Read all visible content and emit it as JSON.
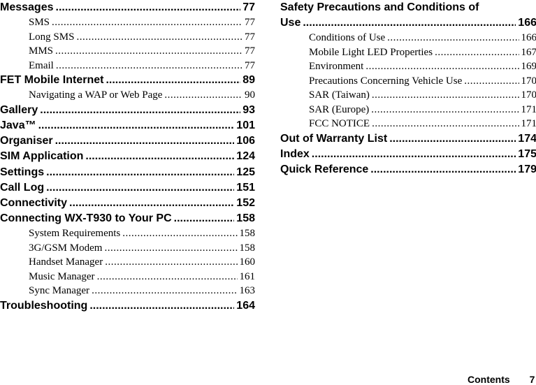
{
  "left": [
    {
      "type": "h",
      "title": "Messages",
      "page": "77"
    },
    {
      "type": "s",
      "title": "SMS",
      "page": "77"
    },
    {
      "type": "s",
      "title": "Long SMS",
      "page": "77"
    },
    {
      "type": "s",
      "title": "MMS",
      "page": "77"
    },
    {
      "type": "s",
      "title": "Email",
      "page": "77"
    },
    {
      "type": "h",
      "title": "FET Mobile Internet",
      "page": "89"
    },
    {
      "type": "s",
      "title": "Navigating a WAP or Web Page",
      "page": "90"
    },
    {
      "type": "h",
      "title": "Gallery",
      "page": "93"
    },
    {
      "type": "h",
      "title": "Java™",
      "page": "101"
    },
    {
      "type": "h",
      "title": "Organiser",
      "page": "106"
    },
    {
      "type": "h",
      "title": "SIM Application",
      "page": "124"
    },
    {
      "type": "h",
      "title": "Settings",
      "page": "125"
    },
    {
      "type": "h",
      "title": "Call Log",
      "page": "151"
    },
    {
      "type": "h",
      "title": "Connectivity",
      "page": "152"
    },
    {
      "type": "h",
      "title": "Connecting WX-T930 to Your PC",
      "page": "158"
    },
    {
      "type": "s",
      "title": "System Requirements",
      "page": "158"
    },
    {
      "type": "s",
      "title": "3G/GSM Modem",
      "page": "158"
    },
    {
      "type": "s",
      "title": "Handset Manager",
      "page": "160"
    },
    {
      "type": "s",
      "title": "Music Manager",
      "page": "161"
    },
    {
      "type": "s",
      "title": "Sync Manager",
      "page": "163"
    },
    {
      "type": "h",
      "title": "Troubleshooting",
      "page": "164"
    }
  ],
  "right_heading_line1": "Safety Precautions and Conditions of",
  "right": [
    {
      "type": "h",
      "title": "Use",
      "page": "166"
    },
    {
      "type": "s",
      "title": "Conditions of Use",
      "page": "166"
    },
    {
      "type": "s",
      "title": "Mobile Light LED Properties",
      "page": "167"
    },
    {
      "type": "s",
      "title": "Environment",
      "page": "169"
    },
    {
      "type": "s",
      "title": "Precautions Concerning Vehicle Use",
      "page": "170"
    },
    {
      "type": "s",
      "title": "SAR (Taiwan)",
      "page": "170"
    },
    {
      "type": "s",
      "title": "SAR (Europe)",
      "page": "171"
    },
    {
      "type": "s",
      "title": "FCC NOTICE",
      "page": "171"
    },
    {
      "type": "h",
      "title": "Out of Warranty List",
      "page": "174"
    },
    {
      "type": "h",
      "title": "Index",
      "page": "175"
    },
    {
      "type": "h",
      "title": "Quick Reference",
      "page": "179"
    }
  ],
  "footer": {
    "section": "Contents",
    "page_number": "7"
  }
}
